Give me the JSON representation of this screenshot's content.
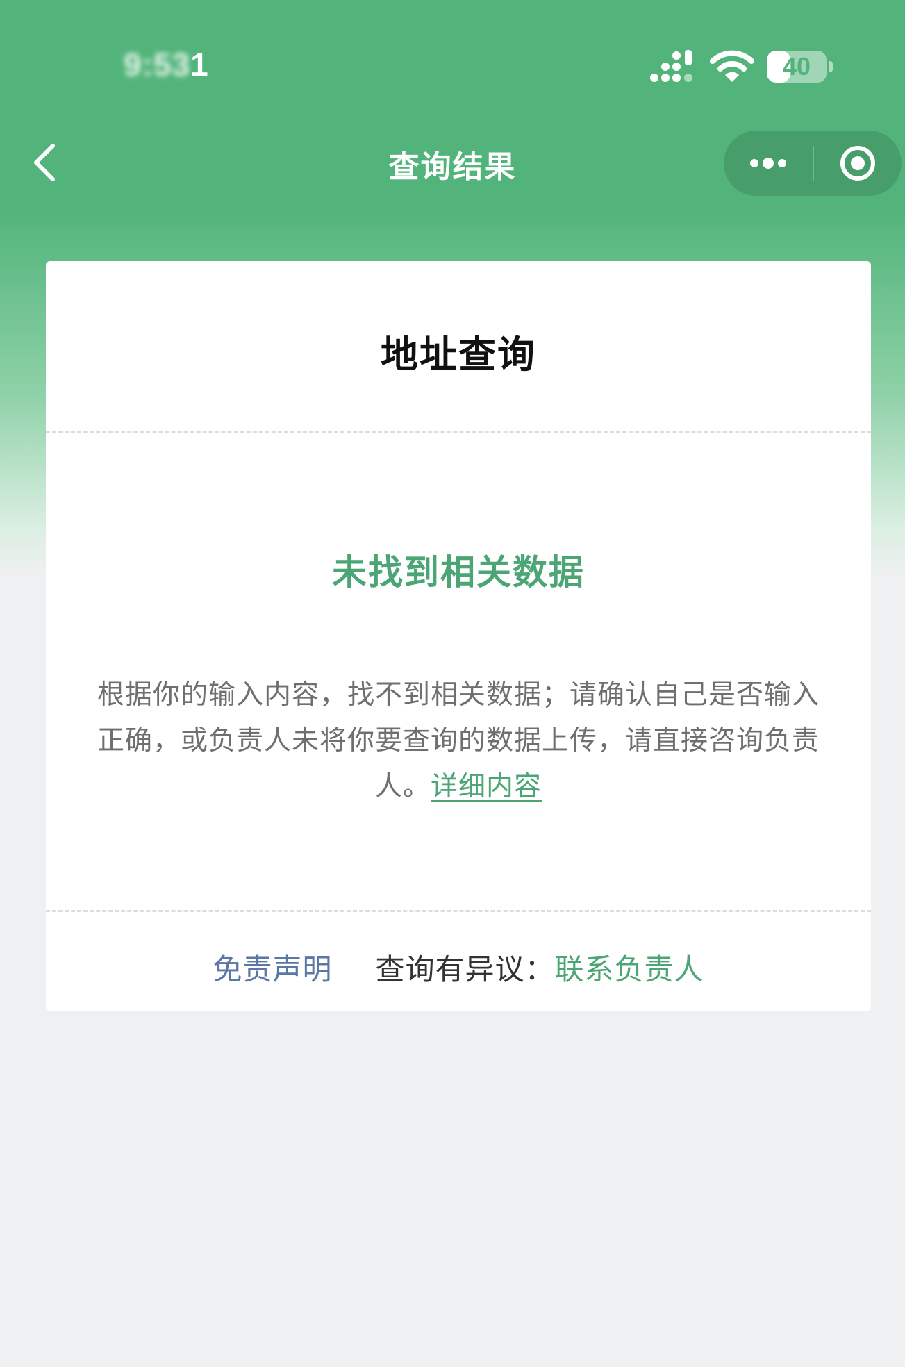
{
  "status_bar": {
    "time_blurred": "9:53",
    "time_visible": "1",
    "battery_level": "40",
    "battery_fraction": 0.4,
    "icons": [
      "signal-icon",
      "wifi-icon",
      "battery-icon"
    ]
  },
  "nav": {
    "back_icon": "chevron-left-icon",
    "title": "查询结果",
    "more_icon": "more-dots-icon",
    "close_icon": "target-close-icon"
  },
  "card": {
    "title": "地址查询",
    "result_heading": "未找到相关数据",
    "result_message": "根据你的输入内容，找不到相关数据；请确认自己是否输入正确，或负责人未将你要查询的数据上传，请直接咨询负责人。",
    "detail_link": "详细内容",
    "footer": {
      "disclaimer": "免责声明",
      "objection_label": "查询有异议：",
      "contact_link": "联系负责人"
    }
  },
  "colors": {
    "header_green": "#52b47a",
    "accent_green": "#4ba574",
    "link_blue": "#5b77a6",
    "page_background": "#eff0f2"
  }
}
